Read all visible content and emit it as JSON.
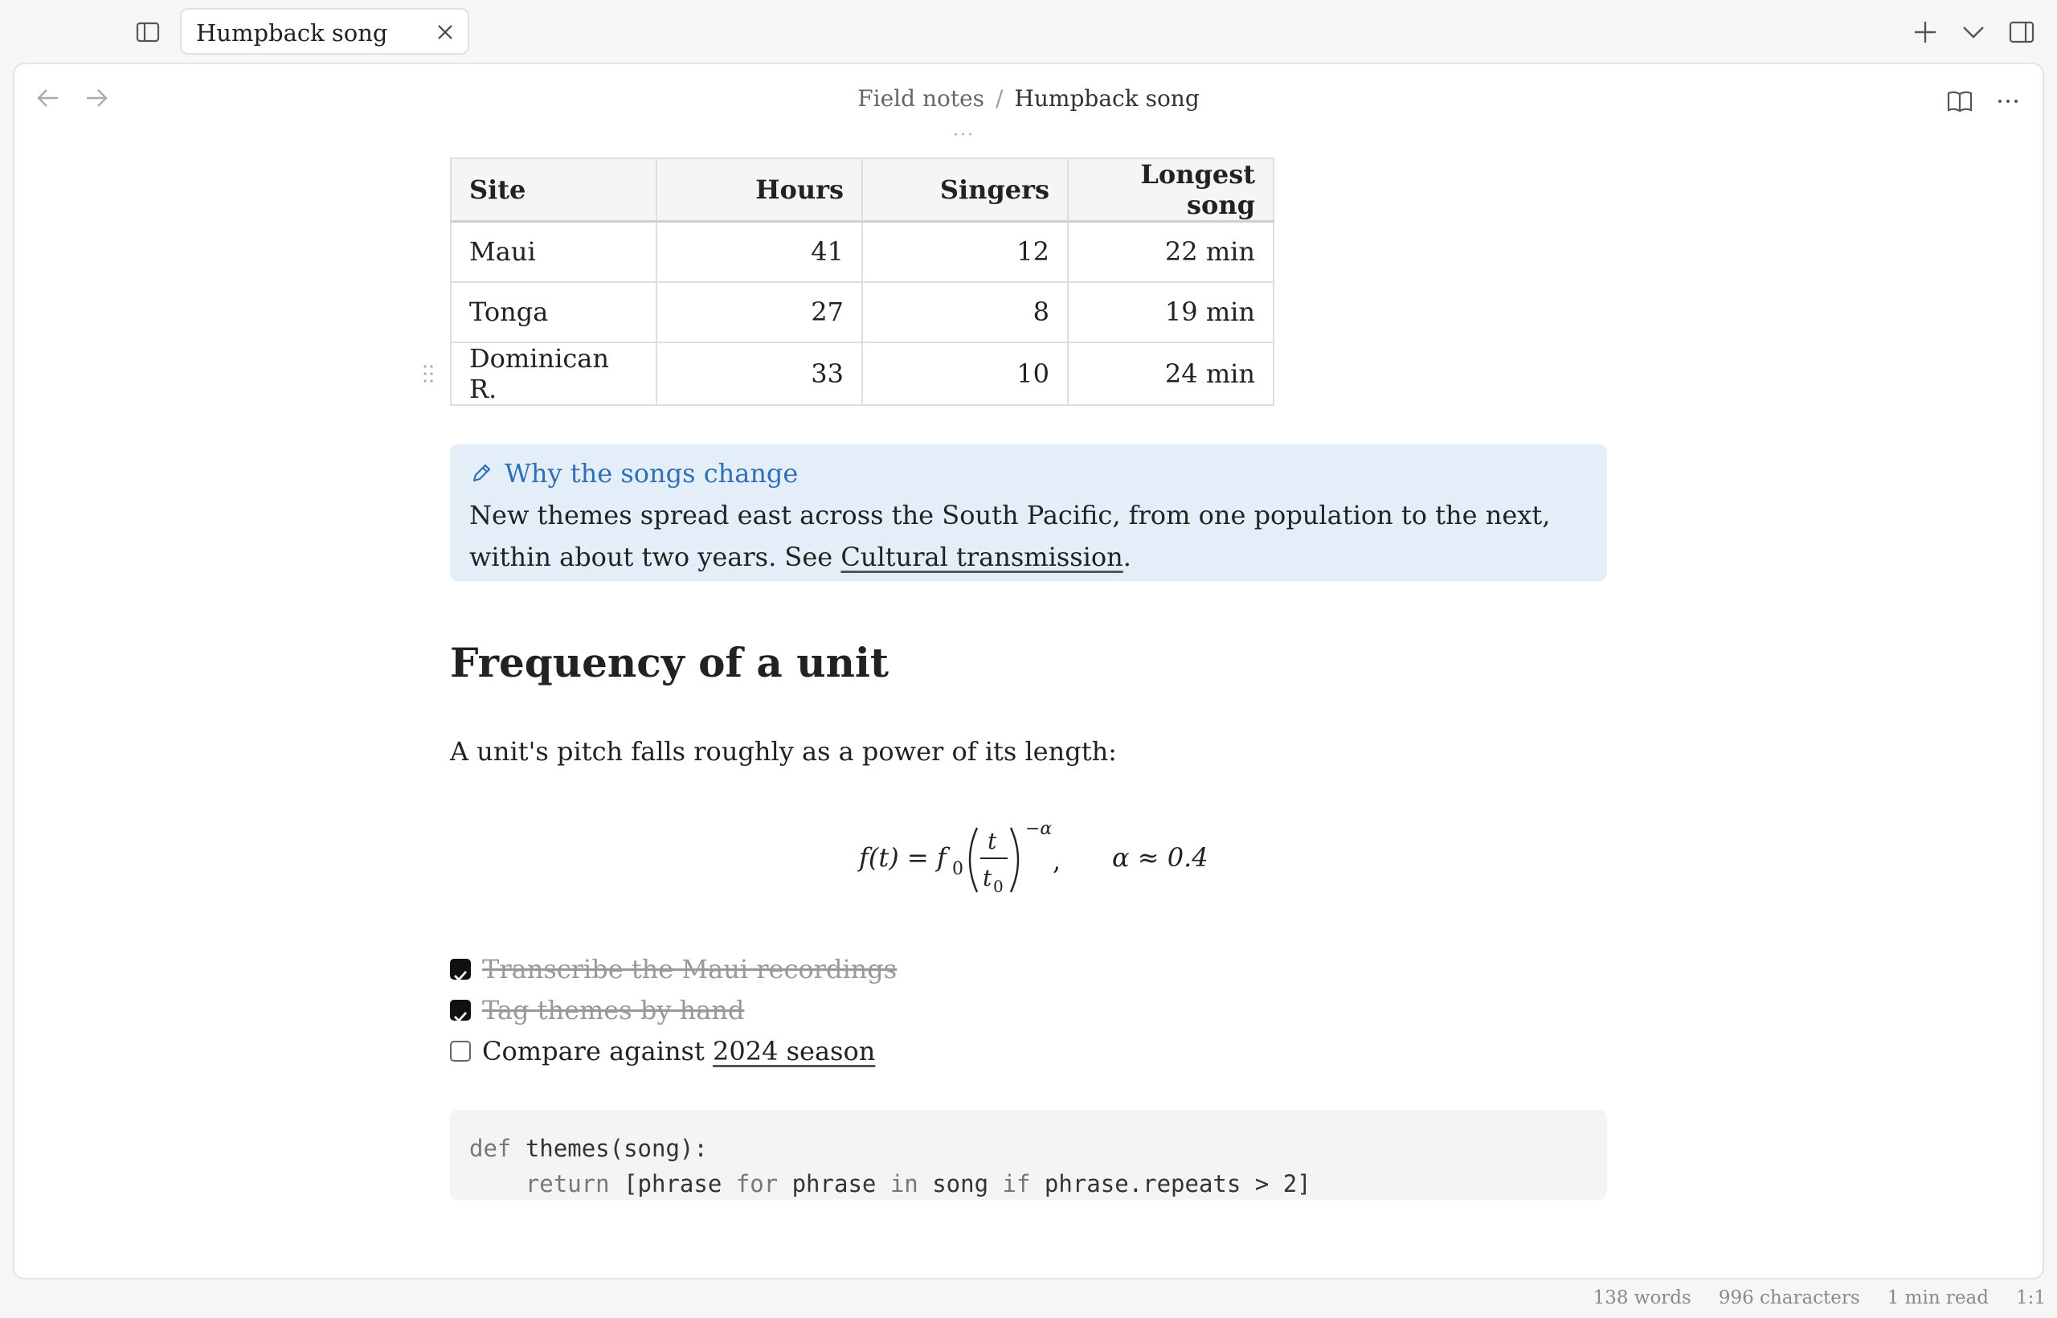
{
  "tab": {
    "title": "Humpback song"
  },
  "breadcrumb": {
    "parent": "Field notes",
    "separator": "/",
    "current": "Humpback song"
  },
  "table": {
    "headers": [
      "Site",
      "Hours",
      "Singers",
      "Longest song"
    ],
    "rows": [
      [
        "Maui",
        "41",
        "12",
        "22 min"
      ],
      [
        "Tonga",
        "27",
        "8",
        "19 min"
      ],
      [
        "Dominican R.",
        "33",
        "10",
        "24 min"
      ]
    ]
  },
  "callout": {
    "title": "Why the songs change",
    "body_text": "New themes spread east across the South Pacific, from one population to the next, within about two years. See ",
    "link": "Cultural transmission",
    "body_end": "."
  },
  "section": {
    "heading": "Frequency of a unit",
    "paragraph": "A unit's pitch falls roughly as a power of its length:"
  },
  "formula": {
    "lhs": "f(t) = f",
    "lhs_sub": "0",
    "numerator": "t",
    "denominator": "t",
    "denominator_sub": "0",
    "exponent": "−α",
    "comma": ",",
    "rhs": "α ≈ 0.4"
  },
  "tasks": [
    {
      "text": "Transcribe the Maui recordings",
      "done": true
    },
    {
      "text": "Tag themes by hand",
      "done": true
    },
    {
      "text": "Compare against ",
      "link": "2024 season",
      "done": false
    }
  ],
  "code": {
    "line1_kw": "def",
    "line1_rest": " themes(song):",
    "line2_indent": "    ",
    "line2_kw": "return",
    "line2_a": " [phrase ",
    "line2_for": "for",
    "line2_b": " phrase ",
    "line2_in": "in",
    "line2_c": " song ",
    "line2_if": "if",
    "line2_d": " phrase.repeats > 2]"
  },
  "status": {
    "words": "138 words",
    "characters": "996 characters",
    "read_time": "1 min read",
    "position": "1:1"
  },
  "colors": {
    "accent": "#2f6fb5",
    "callout_bg": "#e4eef9",
    "code_bg": "#f4f4f4"
  },
  "icons": [
    "sidebar-toggle-icon",
    "close-icon",
    "plus-icon",
    "chevron-down-icon",
    "right-sidebar-icon",
    "arrow-left-icon",
    "arrow-right-icon",
    "book-icon",
    "more-icon",
    "pencil-icon",
    "drag-handle-icon"
  ]
}
